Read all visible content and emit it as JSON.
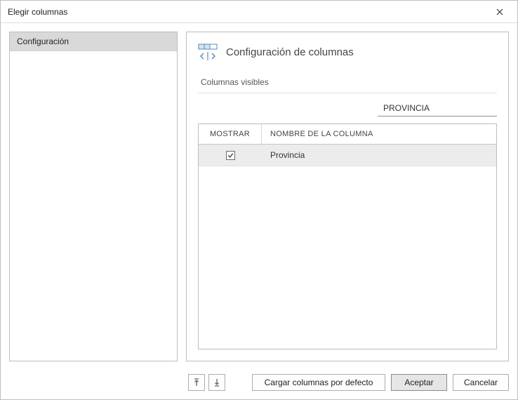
{
  "window": {
    "title": "Elegir columnas"
  },
  "sidebar": {
    "items": [
      {
        "label": "Configuración"
      }
    ]
  },
  "panel": {
    "title": "Configuración de columnas",
    "section_label": "Columnas visibles"
  },
  "search": {
    "value": "PROVINCIA"
  },
  "table": {
    "headers": {
      "show": "MOSTRAR",
      "name": "NOMBRE DE LA COLUMNA"
    },
    "rows": [
      {
        "checked": true,
        "name": "Provincia"
      }
    ]
  },
  "footer": {
    "load_defaults": "Cargar columnas por defecto",
    "accept": "Aceptar",
    "cancel": "Cancelar"
  }
}
